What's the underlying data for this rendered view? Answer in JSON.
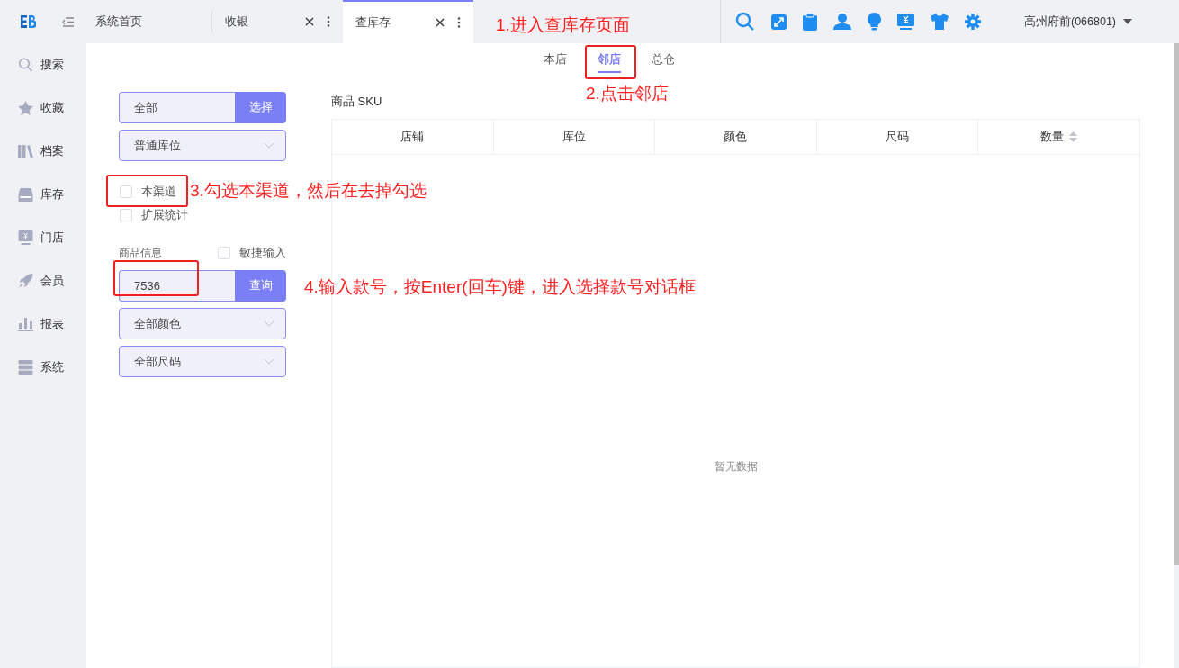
{
  "topbar": {
    "tabs": [
      {
        "label": "系统首页",
        "selected": false,
        "closable": false
      },
      {
        "label": "收银",
        "selected": false,
        "closable": true
      },
      {
        "label": "查库存",
        "selected": true,
        "closable": true
      }
    ],
    "store": "高州府前(066801)"
  },
  "sidebar": {
    "items": [
      {
        "label": "搜索",
        "kind": "search"
      },
      {
        "label": "收藏",
        "kind": "star"
      },
      {
        "label": "档案",
        "kind": "books"
      },
      {
        "label": "库存",
        "kind": "inbox"
      },
      {
        "label": "门店",
        "kind": "monitor"
      },
      {
        "label": "会员",
        "kind": "rocket"
      },
      {
        "label": "报表",
        "kind": "chart"
      },
      {
        "label": "系统",
        "kind": "server"
      }
    ]
  },
  "store_tabs": [
    {
      "label": "本店",
      "selected": false
    },
    {
      "label": "邻店",
      "selected": true
    },
    {
      "label": "总仓",
      "selected": false
    }
  ],
  "filters": {
    "store_value": "全部",
    "select_button": "选择",
    "location": "普通库位",
    "checkboxes": [
      {
        "label": "本渠道",
        "checked": false
      },
      {
        "label": "扩展统计",
        "checked": false
      }
    ],
    "product_label": "商品信息",
    "quick_input": {
      "label": "敏捷输入",
      "checked": false
    },
    "product_value": "7536",
    "query_button": "查询",
    "color_value": "全部颜色",
    "size": "全部尺码"
  },
  "sku_title": "商品 SKU",
  "table": {
    "columns": [
      {
        "label": "店铺",
        "sortable": false
      },
      {
        "label": "库位",
        "sortable": false
      },
      {
        "label": "颜色",
        "sortable": false
      },
      {
        "label": "尺码",
        "sortable": false
      },
      {
        "label": "数量",
        "sortable": true
      }
    ],
    "empty_text": "暂无数据"
  },
  "annotations": [
    {
      "text": "1.进入查库存页面",
      "highlight": false
    },
    {
      "text": "2.点击邻店",
      "highlight": true
    },
    {
      "text": "3.勾选本渠道，然后在去掉勾选",
      "highlight": true
    },
    {
      "text": "4.输入款号，按Enter(回车)键，进入选择款号对话框",
      "highlight": true
    }
  ]
}
